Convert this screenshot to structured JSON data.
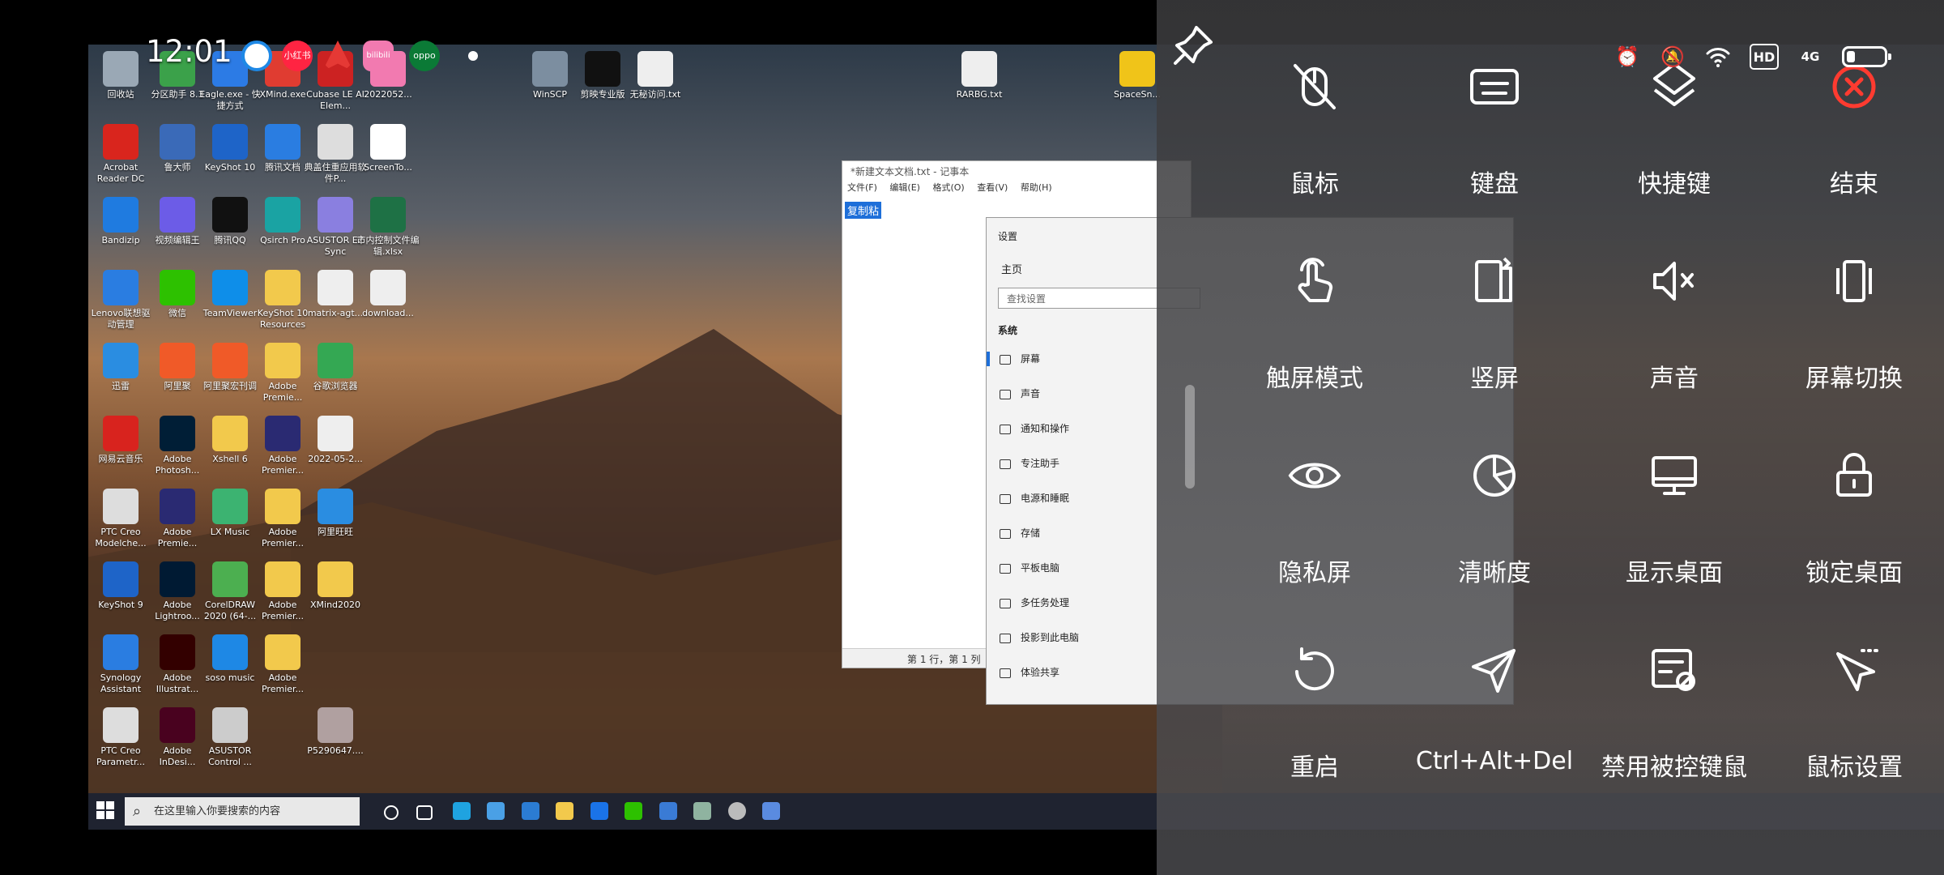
{
  "status_bar": {
    "time": "12:01",
    "badges": [
      "小红书",
      "bilibili",
      "oppo"
    ],
    "hd_label": "HD",
    "network_label": "4G"
  },
  "desktop": {
    "icons": [
      {
        "label": "回收站"
      },
      {
        "label": "分区助手 8.3"
      },
      {
        "label": "Eagle.exe - 快捷方式"
      },
      {
        "label": "XMind.exe"
      },
      {
        "label": "Cubase LE AI Elem..."
      },
      {
        "label": "2022052..."
      },
      {
        "label": "WinSCP"
      },
      {
        "label": "剪映专业版"
      },
      {
        "label": "无秘访问.txt"
      },
      {
        "label": "RARBG.txt"
      },
      {
        "label": "SpaceSn..."
      },
      {
        "label": "Acrobat Reader DC"
      },
      {
        "label": "鲁大师"
      },
      {
        "label": "KeyShot 10"
      },
      {
        "label": "腾讯文档"
      },
      {
        "label": "典盖住重应用软件P..."
      },
      {
        "label": "ScreenTo..."
      },
      {
        "label": "Bandizip"
      },
      {
        "label": "视频编辑王"
      },
      {
        "label": "腾讯QQ"
      },
      {
        "label": "Qsirch Pro"
      },
      {
        "label": "ASUSTOR EZ Sync"
      },
      {
        "label": "市内控制文件编辑.xlsx"
      },
      {
        "label": "Lenovo联想驱动管理"
      },
      {
        "label": "微信"
      },
      {
        "label": "TeamViewer"
      },
      {
        "label": "KeyShot 10 Resources"
      },
      {
        "label": "matrix-agt..."
      },
      {
        "label": "download..."
      },
      {
        "label": "迅雷"
      },
      {
        "label": "阿里聚"
      },
      {
        "label": "阿里聚宏刊调"
      },
      {
        "label": "Adobe Premie..."
      },
      {
        "label": "谷歌浏览器"
      },
      {
        "label": "网易云音乐"
      },
      {
        "label": "Adobe Photosh..."
      },
      {
        "label": "Xshell 6"
      },
      {
        "label": "Adobe Premier..."
      },
      {
        "label": "2022-05-2..."
      },
      {
        "label": "PTC Creo Modelche..."
      },
      {
        "label": "Adobe Premie..."
      },
      {
        "label": "LX Music"
      },
      {
        "label": "Adobe Premier..."
      },
      {
        "label": "阿里旺旺"
      },
      {
        "label": "KeyShot 9"
      },
      {
        "label": "Adobe Lightroo..."
      },
      {
        "label": "CorelDRAW 2020 (64-..."
      },
      {
        "label": "Adobe Premier..."
      },
      {
        "label": "XMind2020"
      },
      {
        "label": "Synology Assistant"
      },
      {
        "label": "Adobe Illustrat..."
      },
      {
        "label": "soso music"
      },
      {
        "label": "Adobe Premier..."
      },
      {
        "label": "PTC Creo Parametr..."
      },
      {
        "label": "Adobe InDesi..."
      },
      {
        "label": "ASUSTOR Control ..."
      },
      {
        "label": "P5290647...."
      }
    ]
  },
  "notepad": {
    "title": "*新建文本文档.txt - 记事本",
    "menu": [
      "文件(F)",
      "编辑(E)",
      "格式(O)",
      "查看(V)",
      "帮助(H)"
    ],
    "selected_text": "复制粘",
    "status": "第 1 行，第 1 列"
  },
  "settings": {
    "title": "设置",
    "home": "主页",
    "search_placeholder": "查找设置",
    "section": "系统",
    "items": [
      "屏幕",
      "声音",
      "通知和操作",
      "专注助手",
      "电源和睡眠",
      "存储",
      "平板电脑",
      "多任务处理",
      "投影到此电脑",
      "体验共享"
    ]
  },
  "taskbar": {
    "search_placeholder": "在这里输入你要搜索的内容"
  },
  "control_panel": {
    "tiles": [
      {
        "label": "鼠标",
        "icon": "mouse-icon"
      },
      {
        "label": "键盘",
        "icon": "keyboard-icon"
      },
      {
        "label": "快捷键",
        "icon": "shortcut-icon"
      },
      {
        "label": "结束",
        "icon": "close-circle-icon"
      },
      {
        "label": "触屏模式",
        "icon": "touch-icon"
      },
      {
        "label": "竖屏",
        "icon": "portrait-icon"
      },
      {
        "label": "声音",
        "icon": "mute-icon"
      },
      {
        "label": "屏幕切换",
        "icon": "screen-switch-icon"
      },
      {
        "label": "隐私屏",
        "icon": "eye-icon"
      },
      {
        "label": "清晰度",
        "icon": "clarity-icon"
      },
      {
        "label": "显示桌面",
        "icon": "desktop-icon"
      },
      {
        "label": "锁定桌面",
        "icon": "lock-icon"
      },
      {
        "label": "重启",
        "icon": "restart-icon"
      },
      {
        "label": "Ctrl+Alt+Del",
        "icon": "send-icon"
      },
      {
        "label": "禁用被控键鼠",
        "icon": "disable-input-icon"
      },
      {
        "label": "鼠标设置",
        "icon": "mouse-settings-icon"
      }
    ],
    "accent_color": "#ff3b30"
  }
}
